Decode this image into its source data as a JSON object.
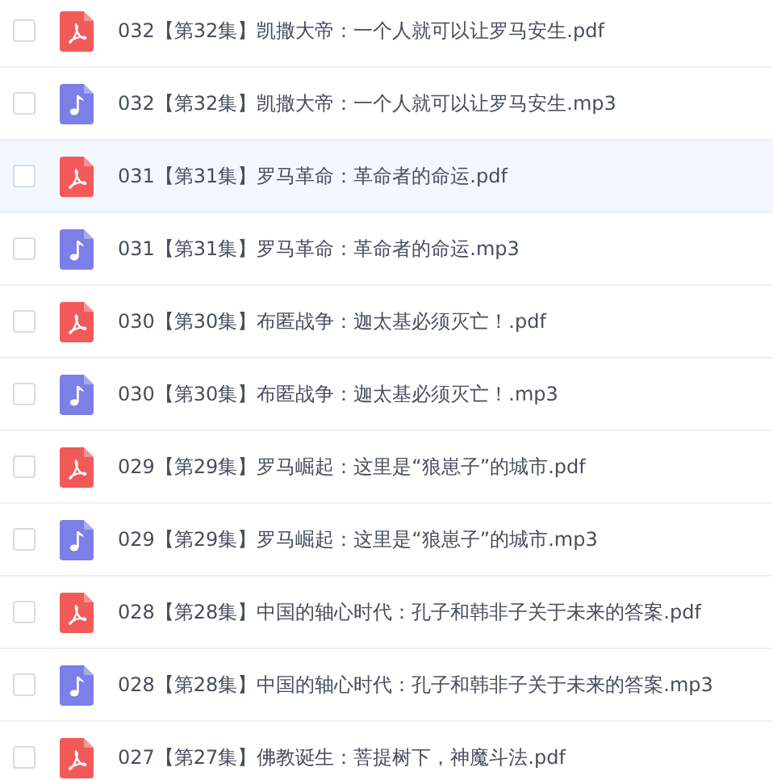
{
  "files": [
    {
      "kind": "pdf",
      "name": "032【第32集】凯撒大帝：一个人就可以让罗马安生.pdf",
      "selected": false,
      "checked": false
    },
    {
      "kind": "mp3",
      "name": "032【第32集】凯撒大帝：一个人就可以让罗马安生.mp3",
      "selected": false,
      "checked": false
    },
    {
      "kind": "pdf",
      "name": "031【第31集】罗马革命：革命者的命运.pdf",
      "selected": true,
      "checked": false
    },
    {
      "kind": "mp3",
      "name": "031【第31集】罗马革命：革命者的命运.mp3",
      "selected": false,
      "checked": false
    },
    {
      "kind": "pdf",
      "name": "030【第30集】布匿战争：迦太基必须灭亡！.pdf",
      "selected": false,
      "checked": false
    },
    {
      "kind": "mp3",
      "name": "030【第30集】布匿战争：迦太基必须灭亡！.mp3",
      "selected": false,
      "checked": false
    },
    {
      "kind": "pdf",
      "name": "029【第29集】罗马崛起：这里是“狼崽子”的城市.pdf",
      "selected": false,
      "checked": false
    },
    {
      "kind": "mp3",
      "name": "029【第29集】罗马崛起：这里是“狼崽子”的城市.mp3",
      "selected": false,
      "checked": false
    },
    {
      "kind": "pdf",
      "name": "028【第28集】中国的轴心时代：孔子和韩非子关于未来的答案.pdf",
      "selected": false,
      "checked": false
    },
    {
      "kind": "mp3",
      "name": "028【第28集】中国的轴心时代：孔子和韩非子关于未来的答案.mp3",
      "selected": false,
      "checked": false
    },
    {
      "kind": "pdf",
      "name": "027【第27集】佛教诞生：菩提树下，神魔斗法.pdf",
      "selected": false,
      "checked": false
    }
  ]
}
